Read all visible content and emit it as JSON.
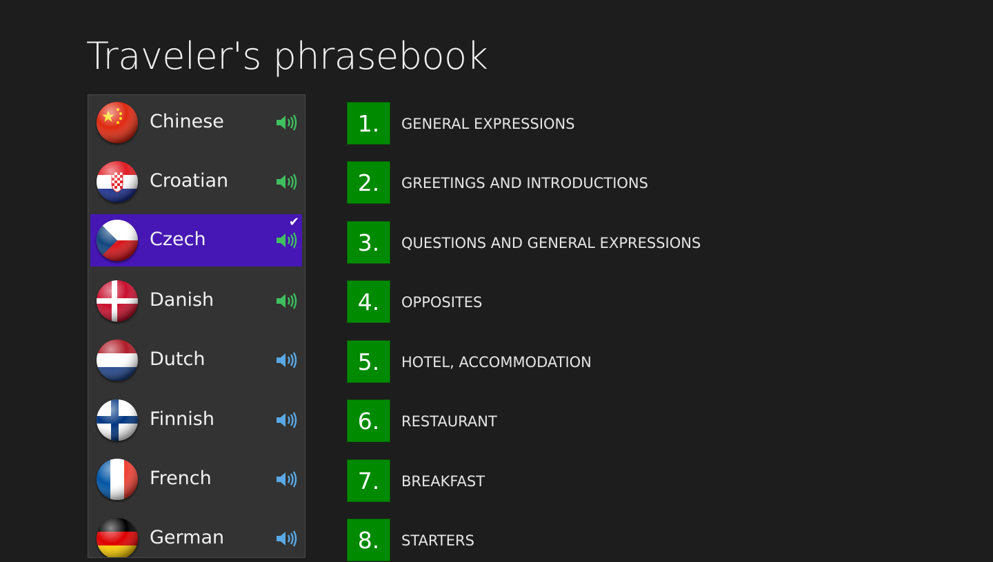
{
  "app": {
    "title": "Traveler's phrasebook"
  },
  "colors": {
    "background": "#1d1d1d",
    "panel": "#333333",
    "selected": "#4617b4",
    "category_tile": "#008a00",
    "speaker_available": "#3fbf5f",
    "speaker_default": "#5aa9e6"
  },
  "languages": [
    {
      "label": "Chinese",
      "flag_icon": "china-flag-icon",
      "speaker_color": "green",
      "selected": false
    },
    {
      "label": "Croatian",
      "flag_icon": "croatia-flag-icon",
      "speaker_color": "green",
      "selected": false
    },
    {
      "label": "Czech",
      "flag_icon": "czech-flag-icon",
      "speaker_color": "green",
      "selected": true,
      "check_mark": "✔"
    },
    {
      "label": "Danish",
      "flag_icon": "denmark-flag-icon",
      "speaker_color": "green",
      "selected": false
    },
    {
      "label": "Dutch",
      "flag_icon": "netherlands-flag-icon",
      "speaker_color": "blue",
      "selected": false
    },
    {
      "label": "Finnish",
      "flag_icon": "finland-flag-icon",
      "speaker_color": "blue",
      "selected": false
    },
    {
      "label": "French",
      "flag_icon": "france-flag-icon",
      "speaker_color": "blue",
      "selected": false
    },
    {
      "label": "German",
      "flag_icon": "germany-flag-icon",
      "speaker_color": "blue",
      "selected": false
    }
  ],
  "categories": [
    {
      "number": "1.",
      "label": "GENERAL EXPRESSIONS"
    },
    {
      "number": "2.",
      "label": "GREETINGS AND INTRODUCTIONS"
    },
    {
      "number": "3.",
      "label": "QUESTIONS AND GENERAL EXPRESSIONS"
    },
    {
      "number": "4.",
      "label": "OPPOSITES"
    },
    {
      "number": "5.",
      "label": "HOTEL, ACCOMMODATION"
    },
    {
      "number": "6.",
      "label": "RESTAURANT"
    },
    {
      "number": "7.",
      "label": "BREAKFAST"
    },
    {
      "number": "8.",
      "label": "STARTERS"
    }
  ]
}
